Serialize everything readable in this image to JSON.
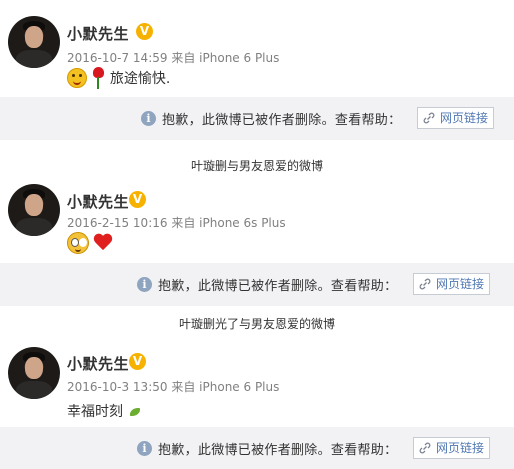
{
  "posts": [
    {
      "author": "小默先生",
      "timestamp": "2016-10-7 14:59",
      "source_prefix": "来自",
      "device": "iPhone 6 Plus",
      "text": "旅途愉快."
    },
    {
      "author": "小默先生",
      "timestamp": "2016-2-15 10:16",
      "source_prefix": "来自",
      "device": "iPhone 6s Plus",
      "text": ""
    },
    {
      "author": "小默先生",
      "timestamp": "2016-10-3 13:50",
      "source_prefix": "来自",
      "device": "iPhone 6 Plus",
      "text": "幸福时刻"
    }
  ],
  "notice": {
    "message": "抱歉，此微博已被作者删除。查看帮助：",
    "link_label": "网页链接"
  },
  "captions": [
    "叶璇删与男友恩爱的微博",
    "叶璇删光了与男友恩爱的微博"
  ],
  "icons": {
    "verified": "verified-badge-icon",
    "info": "info-icon",
    "link": "link-icon"
  },
  "colors": {
    "verified_badge": "#f7b200",
    "notice_bg": "#f2f2f5",
    "link_text": "#5078b3",
    "meta_text": "#808080"
  }
}
